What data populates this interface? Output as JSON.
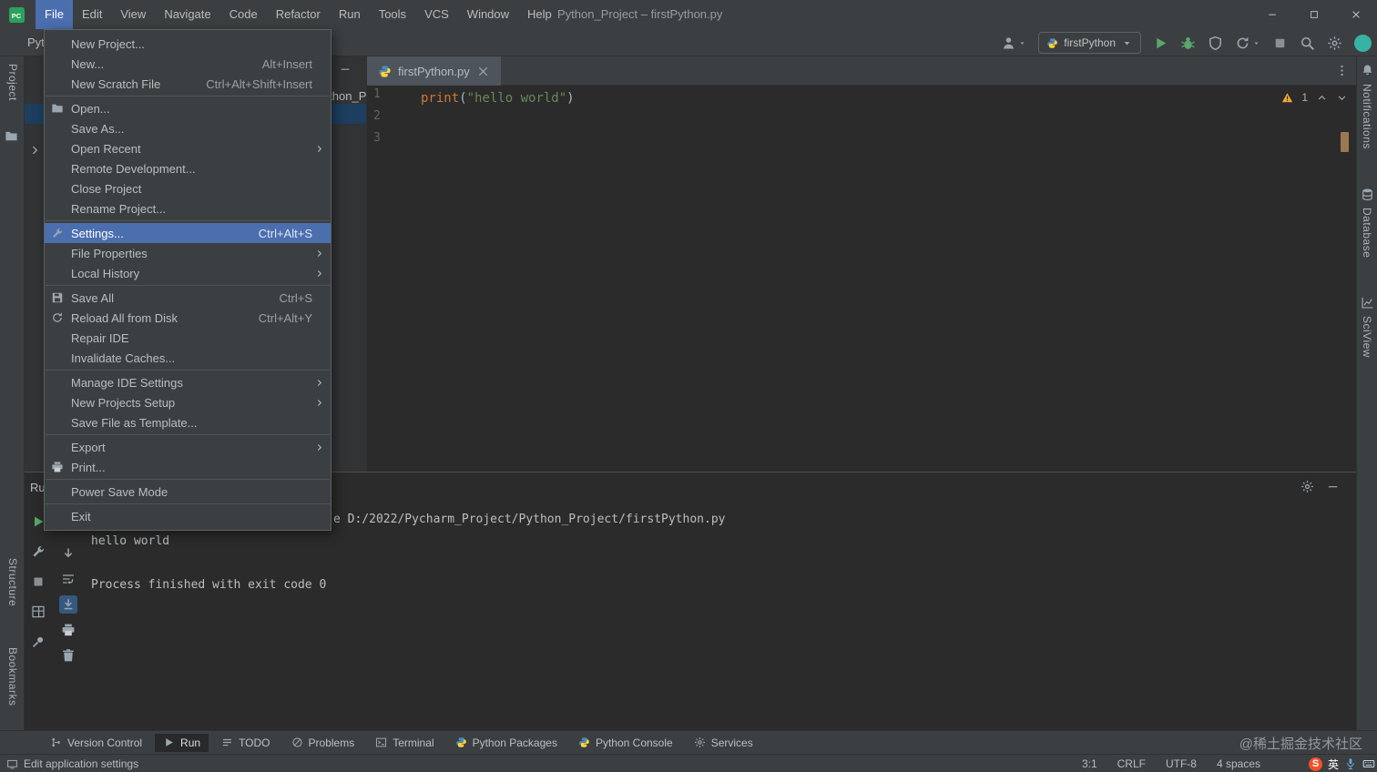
{
  "titlebar": {
    "title": "Python_Project – firstPython.py",
    "menus": [
      {
        "label": "File",
        "active": true
      },
      {
        "label": "Edit"
      },
      {
        "label": "View"
      },
      {
        "label": "Navigate"
      },
      {
        "label": "Code"
      },
      {
        "label": "Refactor"
      },
      {
        "label": "Run"
      },
      {
        "label": "Tools"
      },
      {
        "label": "VCS"
      },
      {
        "label": "Window"
      },
      {
        "label": "Help"
      }
    ]
  },
  "navbar": {
    "breadcrumb": "Python_Project",
    "run_config": "firstPython"
  },
  "file_menu": {
    "items": [
      {
        "label": "New Project..."
      },
      {
        "label": "New...",
        "shortcut": "Alt+Insert"
      },
      {
        "label": "New Scratch File",
        "shortcut": "Ctrl+Alt+Shift+Insert"
      },
      {
        "sep": true
      },
      {
        "label": "Open...",
        "icon": "folder"
      },
      {
        "label": "Save As..."
      },
      {
        "label": "Open Recent",
        "submenu": true
      },
      {
        "label": "Remote Development..."
      },
      {
        "label": "Close Project"
      },
      {
        "label": "Rename Project..."
      },
      {
        "sep": true
      },
      {
        "label": "Settings...",
        "icon": "wrench",
        "shortcut": "Ctrl+Alt+S",
        "selected": true
      },
      {
        "label": "File Properties",
        "submenu": true
      },
      {
        "label": "Local History",
        "submenu": true
      },
      {
        "sep": true
      },
      {
        "label": "Save All",
        "icon": "floppy",
        "shortcut": "Ctrl+S"
      },
      {
        "label": "Reload All from Disk",
        "icon": "reload",
        "shortcut": "Ctrl+Alt+Y"
      },
      {
        "label": "Repair IDE"
      },
      {
        "label": "Invalidate Caches..."
      },
      {
        "sep": true
      },
      {
        "label": "Manage IDE Settings",
        "submenu": true
      },
      {
        "label": "New Projects Setup",
        "submenu": true
      },
      {
        "label": "Save File as Template..."
      },
      {
        "sep": true
      },
      {
        "label": "Export",
        "submenu": true
      },
      {
        "label": "Print...",
        "icon": "printer"
      },
      {
        "sep": true
      },
      {
        "label": "Power Save Mode"
      },
      {
        "sep": true
      },
      {
        "label": "Exit"
      }
    ]
  },
  "project_panel": {
    "root_label": "Python_Project"
  },
  "editor": {
    "tab_label": "firstPython.py",
    "line_numbers": [
      "1",
      "2",
      "3"
    ],
    "code_tokens": [
      {
        "text": "print",
        "style": "fn"
      },
      {
        "text": "(",
        "style": "pln"
      },
      {
        "text": "\"hello world\"",
        "style": "str"
      },
      {
        "text": ")",
        "style": "pln"
      }
    ],
    "warning_count": "1"
  },
  "run_panel": {
    "title": "Run",
    "toolbar_main": [
      {
        "icon": "play",
        "name": "rerun-button"
      },
      {
        "icon": "wrench",
        "name": "edit-configuration-button"
      },
      {
        "icon": "stop",
        "name": "stop-button"
      },
      {
        "icon": "grid",
        "name": "restore-layout-button"
      },
      {
        "icon": "pin",
        "name": "pin-tab-button"
      }
    ],
    "toolbar_console": [
      {
        "icon": "downarrow",
        "name": "down-the-stack-trace-button"
      },
      {
        "icon": "softwrap",
        "name": "soft-wrap-button"
      },
      {
        "icon": "scrollend",
        "name": "scroll-to-end-button",
        "active": true
      },
      {
        "icon": "printer",
        "name": "print-console-button"
      },
      {
        "icon": "trash",
        "name": "clear-all-button"
      }
    ],
    "console": {
      "lines": [
        {
          "text": "e D:/2022/Pycharm_Project/Python_Project/firstPython.py",
          "cmd": true
        },
        {
          "text": "hello world"
        },
        {
          "text": ""
        },
        {
          "text": "Process finished with exit code 0"
        }
      ]
    }
  },
  "bottom_bar": {
    "buttons": [
      {
        "label": "Version Control",
        "icon": "vcs"
      },
      {
        "label": "Run",
        "icon": "playgray",
        "active": true
      },
      {
        "label": "TODO",
        "icon": "todo"
      },
      {
        "label": "Problems",
        "icon": "problems"
      },
      {
        "label": "Terminal",
        "icon": "terminal"
      },
      {
        "label": "Python Packages",
        "icon": "python"
      },
      {
        "label": "Python Console",
        "icon": "python"
      },
      {
        "label": "Services",
        "icon": "gear"
      }
    ],
    "watermark": "@稀土掘金技术社区"
  },
  "statusbar": {
    "left_text": "Edit application settings",
    "segments": [
      "3:1",
      "CRLF",
      "UTF-8",
      "4 spaces"
    ],
    "ime": {
      "logo_letter": "S",
      "lang_label": "英"
    }
  },
  "left_bar": {
    "project": "Project",
    "structure": "Structure",
    "bookmarks": "Bookmarks"
  },
  "right_bar": {
    "items": [
      {
        "icon": "bell",
        "label": "Notifications"
      },
      {
        "icon": "database",
        "label": "Database"
      },
      {
        "icon": "sciview",
        "label": "SciView"
      }
    ]
  },
  "colors": {
    "selection_blue": "#4b6eaf",
    "run_green": "#59a869",
    "warning_yellow": "#f0a732",
    "string_green": "#6a8759",
    "keyword_orange": "#cc7832",
    "panel_bg": "#3c3f41",
    "editor_bg": "#2b2b2b"
  }
}
